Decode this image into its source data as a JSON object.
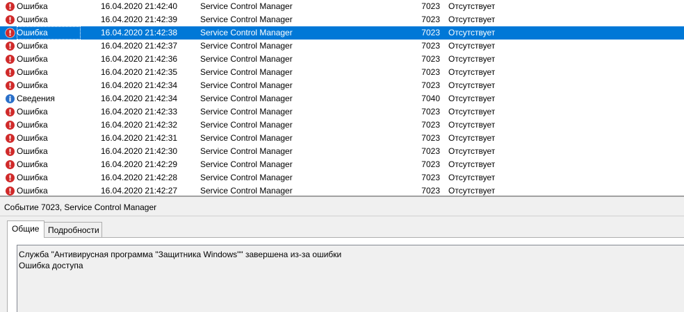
{
  "events": [
    {
      "level": "Ошибка",
      "type": "error",
      "date": "16.04.2020 21:42:40",
      "source": "Service Control Manager",
      "id": "7023",
      "task": "Отсутствует",
      "selected": false
    },
    {
      "level": "Ошибка",
      "type": "error",
      "date": "16.04.2020 21:42:39",
      "source": "Service Control Manager",
      "id": "7023",
      "task": "Отсутствует",
      "selected": false
    },
    {
      "level": "Ошибка",
      "type": "error",
      "date": "16.04.2020 21:42:38",
      "source": "Service Control Manager",
      "id": "7023",
      "task": "Отсутствует",
      "selected": true
    },
    {
      "level": "Ошибка",
      "type": "error",
      "date": "16.04.2020 21:42:37",
      "source": "Service Control Manager",
      "id": "7023",
      "task": "Отсутствует",
      "selected": false
    },
    {
      "level": "Ошибка",
      "type": "error",
      "date": "16.04.2020 21:42:36",
      "source": "Service Control Manager",
      "id": "7023",
      "task": "Отсутствует",
      "selected": false
    },
    {
      "level": "Ошибка",
      "type": "error",
      "date": "16.04.2020 21:42:35",
      "source": "Service Control Manager",
      "id": "7023",
      "task": "Отсутствует",
      "selected": false
    },
    {
      "level": "Ошибка",
      "type": "error",
      "date": "16.04.2020 21:42:34",
      "source": "Service Control Manager",
      "id": "7023",
      "task": "Отсутствует",
      "selected": false
    },
    {
      "level": "Сведения",
      "type": "info",
      "date": "16.04.2020 21:42:34",
      "source": "Service Control Manager",
      "id": "7040",
      "task": "Отсутствует",
      "selected": false
    },
    {
      "level": "Ошибка",
      "type": "error",
      "date": "16.04.2020 21:42:33",
      "source": "Service Control Manager",
      "id": "7023",
      "task": "Отсутствует",
      "selected": false
    },
    {
      "level": "Ошибка",
      "type": "error",
      "date": "16.04.2020 21:42:32",
      "source": "Service Control Manager",
      "id": "7023",
      "task": "Отсутствует",
      "selected": false
    },
    {
      "level": "Ошибка",
      "type": "error",
      "date": "16.04.2020 21:42:31",
      "source": "Service Control Manager",
      "id": "7023",
      "task": "Отсутствует",
      "selected": false
    },
    {
      "level": "Ошибка",
      "type": "error",
      "date": "16.04.2020 21:42:30",
      "source": "Service Control Manager",
      "id": "7023",
      "task": "Отсутствует",
      "selected": false
    },
    {
      "level": "Ошибка",
      "type": "error",
      "date": "16.04.2020 21:42:29",
      "source": "Service Control Manager",
      "id": "7023",
      "task": "Отсутствует",
      "selected": false
    },
    {
      "level": "Ошибка",
      "type": "error",
      "date": "16.04.2020 21:42:28",
      "source": "Service Control Manager",
      "id": "7023",
      "task": "Отсутствует",
      "selected": false
    },
    {
      "level": "Ошибка",
      "type": "error",
      "date": "16.04.2020 21:42:27",
      "source": "Service Control Manager",
      "id": "7023",
      "task": "Отсутствует",
      "selected": false
    }
  ],
  "icons": {
    "error": "error-icon",
    "info": "info-icon"
  },
  "colors": {
    "selection": "#0078d7",
    "error_icon": "#d02a2a",
    "info_icon": "#2a6fc9"
  },
  "detail": {
    "title": "Событие 7023, Service Control Manager",
    "tabs": {
      "general": "Общие",
      "details": "Подробности"
    },
    "message": {
      "line1": "Служба \"Антивирусная программа \"Защитника Windows\"\" завершена из-за ошибки",
      "line2": "Ошибка доступа"
    }
  }
}
